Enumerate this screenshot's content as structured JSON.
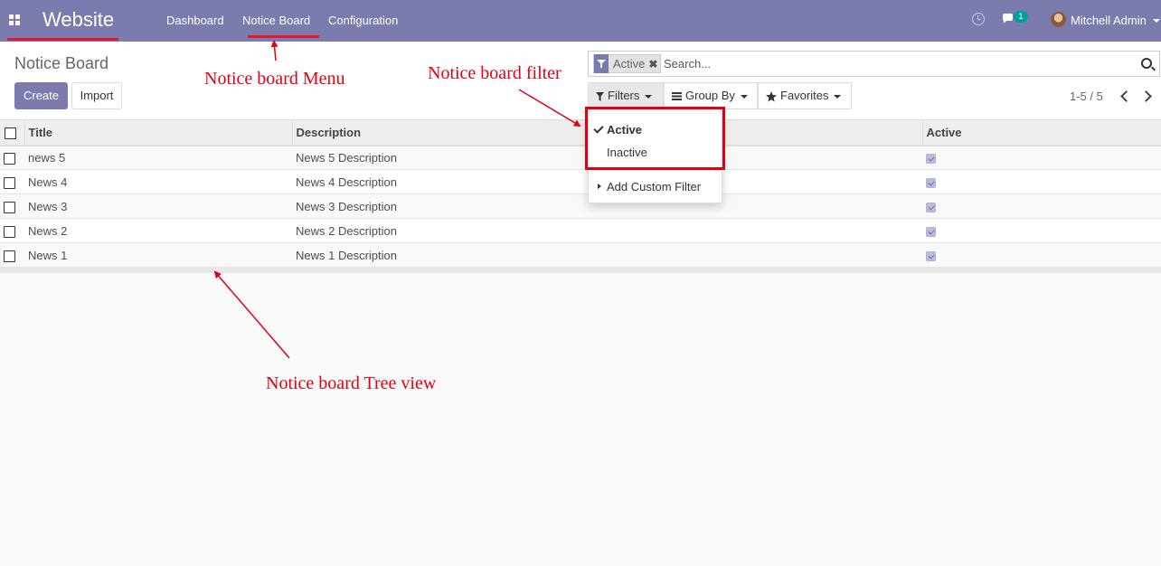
{
  "navbar": {
    "brand": "Website",
    "menus": [
      "Dashboard",
      "Notice Board",
      "Configuration"
    ],
    "chat_badge": "1",
    "user_name": "Mitchell Admin",
    "color": "#7c7bad"
  },
  "control_panel": {
    "title": "Notice Board",
    "create_label": "Create",
    "import_label": "Import",
    "search": {
      "facet_label": "Active",
      "placeholder": "Search..."
    },
    "filters_label": "Filters",
    "groupby_label": "Group By",
    "favorites_label": "Favorites",
    "pager": "1-5 / 5"
  },
  "filters_dropdown": {
    "items": [
      "Active",
      "Inactive"
    ],
    "selected": "Active",
    "custom_label": "Add Custom Filter"
  },
  "table": {
    "columns": [
      "Title",
      "Description",
      "Active"
    ],
    "rows": [
      {
        "title": "news 5",
        "description": "News 5 Description",
        "active": true
      },
      {
        "title": "News 4",
        "description": "News 4 Description",
        "active": true
      },
      {
        "title": "News 3",
        "description": "News 3 Description",
        "active": true
      },
      {
        "title": "News 2",
        "description": "News 2 Description",
        "active": true
      },
      {
        "title": "News 1",
        "description": "News 1 Description",
        "active": true
      }
    ]
  },
  "annotations": {
    "menu": "Notice board Menu",
    "filter": "Notice board filter",
    "tree": "Notice board Tree view",
    "color": "#e00014"
  }
}
